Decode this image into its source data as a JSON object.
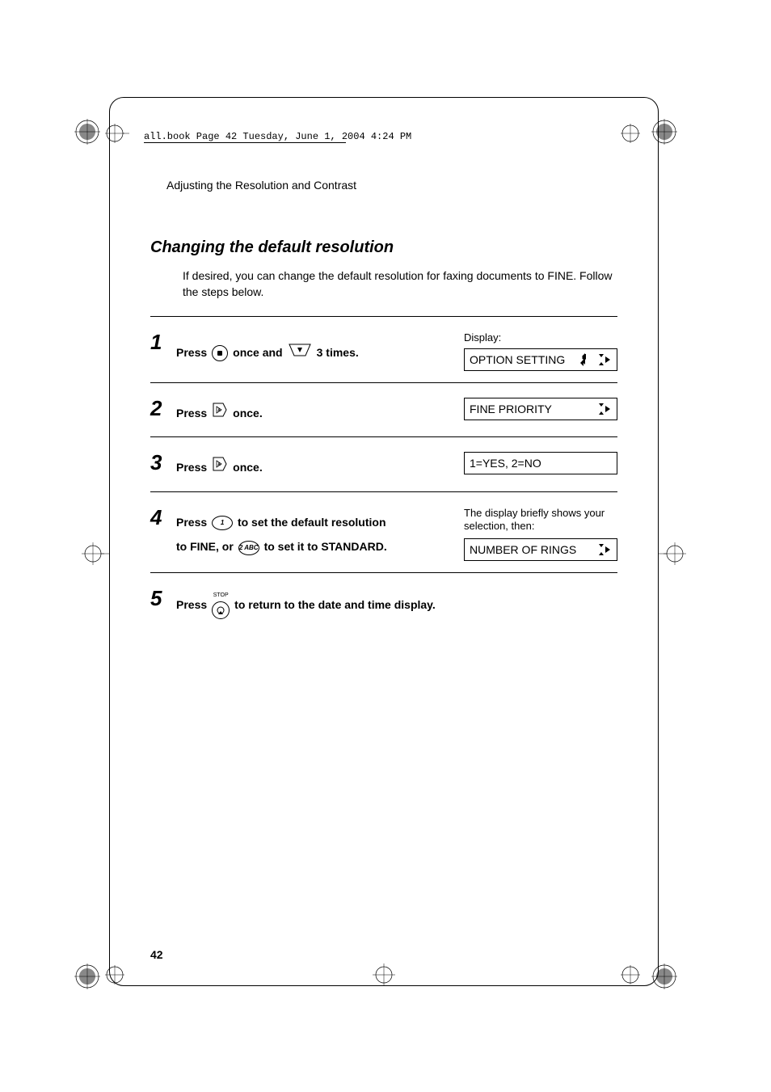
{
  "book_header": "all.book  Page 42  Tuesday, June 1, 2004  4:24 PM",
  "chapter_header": "Adjusting the Resolution and Contrast",
  "section_title": "Changing the default resolution",
  "intro": "If desired, you can change the default resolution for faxing documents to FINE. Follow the steps below.",
  "steps": [
    {
      "num": "1",
      "parts_a": "Press ",
      "parts_b": " once and ",
      "parts_c": " 3 times.",
      "right_label": "Display:",
      "lcd": "OPTION SETTING"
    },
    {
      "num": "2",
      "parts_a": "Press ",
      "parts_c": " once.",
      "lcd": "FINE PRIORITY"
    },
    {
      "num": "3",
      "parts_a": "Press ",
      "parts_c": " once.",
      "lcd": "1=YES, 2=NO"
    },
    {
      "num": "4",
      "line1_a": "Press ",
      "line1_b": " to set the default resolution",
      "line2_a": "to FINE, or ",
      "line2_b": " to set it to STANDARD.",
      "right_note": "The display briefly shows your selection, then:",
      "lcd": "NUMBER OF RINGS"
    },
    {
      "num": "5",
      "parts_a": "Press ",
      "parts_c": " to return to the date and time display."
    }
  ],
  "page_number": "42",
  "icons": {
    "func": "F",
    "one": "1",
    "two": "2 ABC",
    "stop_label": "STOP"
  }
}
